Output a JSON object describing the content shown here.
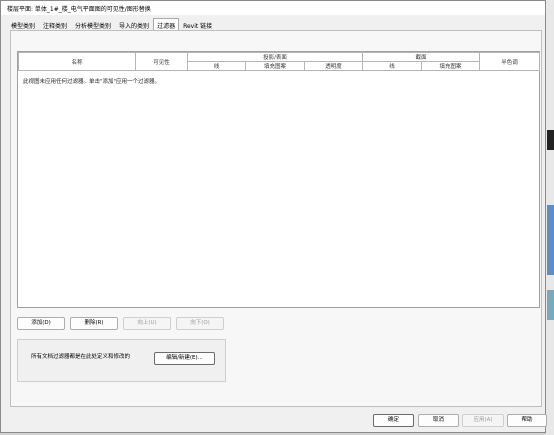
{
  "window": {
    "title": "楼层平面: 单体_1#_楼_电气平面图的可见性/图形替换"
  },
  "tabs": [
    {
      "label": "模型类别"
    },
    {
      "label": "注释类别"
    },
    {
      "label": "分析模型类别"
    },
    {
      "label": "导入的类别"
    },
    {
      "label": "过滤器"
    },
    {
      "label": "Revit 链接"
    }
  ],
  "grid": {
    "headers": {
      "name": "名称",
      "visibility": "可见性",
      "projection_surface": "投影/表面",
      "cut": "截面",
      "halftone": "半色调",
      "line": "线",
      "fill_pattern": "填充图案",
      "transparency": "透明度",
      "cut_line": "线",
      "cut_fill_pattern": "填充图案"
    },
    "empty_message": "此视图未应用任何过滤器。单击\"添加\"应用一个过滤器。"
  },
  "buttons": {
    "add": "添加(D)",
    "delete": "删除(R)",
    "up": "向上(U)",
    "down": "向下(O)",
    "edit_new": "编辑/新建(E)...",
    "ok": "确定",
    "cancel": "取消",
    "apply": "应用(A)",
    "help": "帮助"
  },
  "info": {
    "text": "所有文档过滤器都是在此处定义和修改的"
  }
}
